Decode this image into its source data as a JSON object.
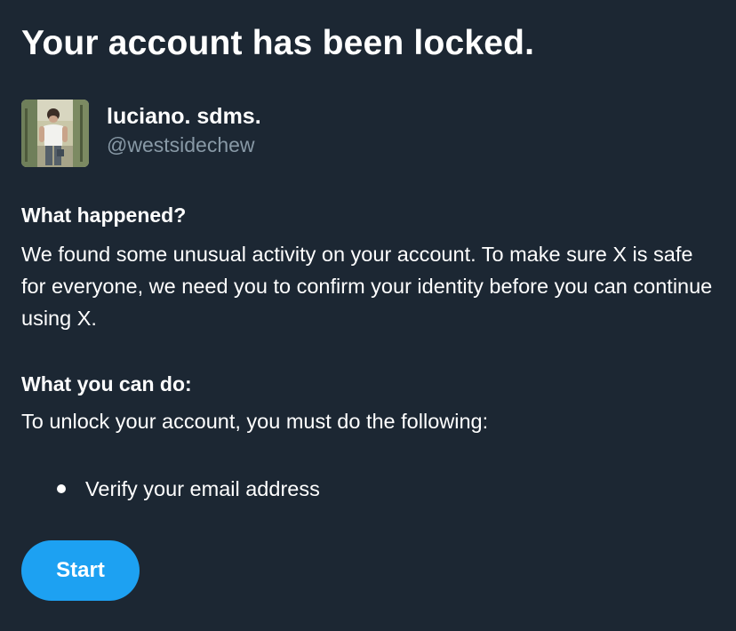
{
  "header": {
    "title": "Your account has been locked."
  },
  "profile": {
    "display_name": "luciano. sdms.",
    "handle": "@westsidechew",
    "avatar_icon": "profile-photo"
  },
  "what_happened": {
    "heading": "What happened?",
    "text": "We found some unusual activity on your account. To make sure X is safe for everyone, we need you to confirm your identity before you can continue using X."
  },
  "what_you_can_do": {
    "heading": "What you can do:",
    "text": "To unlock your account, you must do the following:",
    "steps": [
      {
        "label": "Verify your email address"
      }
    ]
  },
  "actions": {
    "start_label": "Start"
  },
  "colors": {
    "background": "#1c2733",
    "text": "#ffffff",
    "secondary_text": "#8899a6",
    "accent": "#1da1f2"
  }
}
